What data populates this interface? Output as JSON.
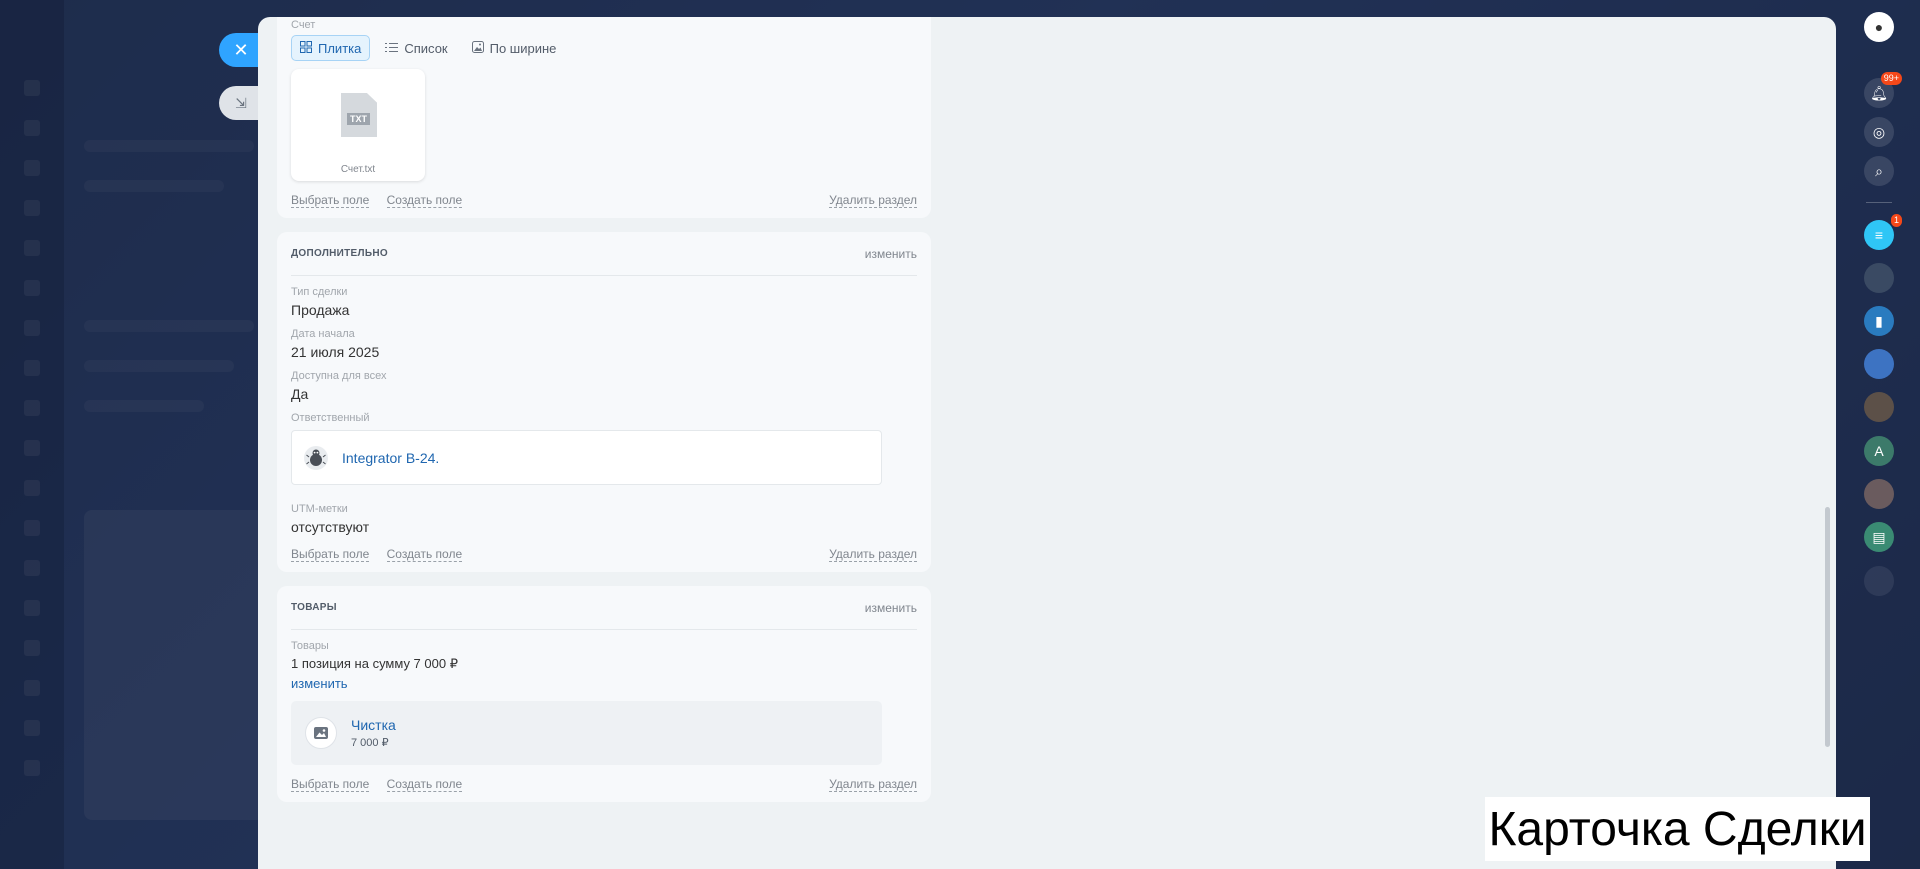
{
  "file_section": {
    "label": "Счет",
    "tabs": [
      {
        "label": "Плитка"
      },
      {
        "label": "Список"
      },
      {
        "label": "По ширине"
      }
    ],
    "file": {
      "name": "Счет.txt",
      "badge": "TXT"
    }
  },
  "footer": {
    "select_field": "Выбрать поле",
    "create_field": "Создать поле",
    "delete_section": "Удалить раздел"
  },
  "additional": {
    "title": "ДОПОЛНИТЕЛЬНО",
    "edit": "изменить",
    "fields": [
      {
        "label": "Тип сделки",
        "value": "Продажа"
      },
      {
        "label": "Дата начала",
        "value": "21 июля 2025"
      },
      {
        "label": "Доступна для всех",
        "value": "Да"
      }
    ],
    "responsible_label": "Ответственный",
    "responsible_name": "Integrator B-24.",
    "utm_label": "UTM-метки",
    "utm_value": "отсутствуют"
  },
  "products": {
    "title": "ТОВАРЫ",
    "edit": "изменить",
    "label": "Товары",
    "summary": "1 позиция на сумму 7 000 ₽",
    "change_link": "изменить",
    "item": {
      "name": "Чистка",
      "price": "7 000 ₽"
    }
  },
  "rightbar": {
    "notifications_badge": "99+",
    "chat_badge": "1",
    "avatar_letter": "A"
  },
  "caption": "Карточка Сделки"
}
